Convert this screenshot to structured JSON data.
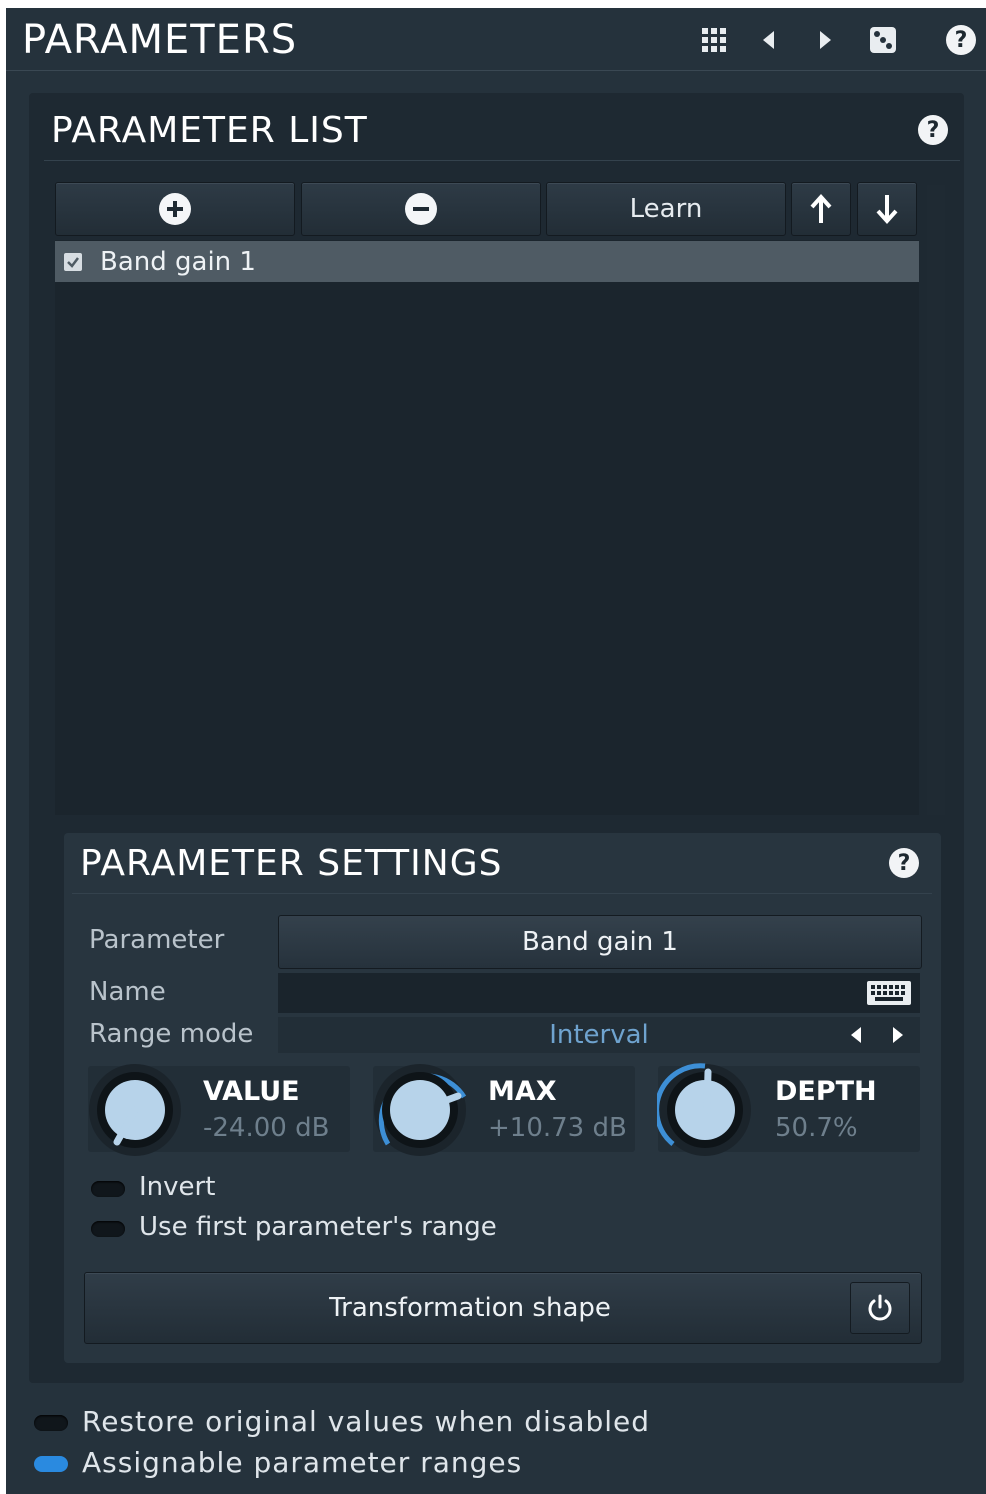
{
  "header": {
    "title": "PARAMETERS",
    "icons": [
      "grid-icon",
      "prev-arrow-icon",
      "next-arrow-icon",
      "dice-icon",
      "help-icon"
    ],
    "help_glyph": "?"
  },
  "parameter_list": {
    "title": "PARAMETER LIST",
    "help_glyph": "?",
    "toolbar": {
      "learn_label": "Learn"
    },
    "items": [
      {
        "label": "Band gain 1",
        "checked": true,
        "selected": true
      }
    ]
  },
  "parameter_settings": {
    "title": "PARAMETER SETTINGS",
    "help_glyph": "?",
    "parameter_label": "Parameter",
    "parameter_value": "Band gain 1",
    "name_label": "Name",
    "name_value": "",
    "range_mode_label": "Range mode",
    "range_mode_value": "Interval",
    "knobs": {
      "value": {
        "name": "VALUE",
        "display": "-24.00 dB"
      },
      "max": {
        "name": "MAX",
        "display": "+10.73 dB"
      },
      "depth": {
        "name": "DEPTH",
        "display": "50.7%"
      }
    },
    "invert_label": "Invert",
    "invert_on": false,
    "use_first_range_label": "Use first parameter's range",
    "use_first_range_on": false,
    "transformation_shape_label": "Transformation shape"
  },
  "footer": {
    "restore_label": "Restore original values when disabled",
    "restore_on": false,
    "assignable_label": "Assignable parameter ranges",
    "assignable_on": true
  },
  "colors": {
    "accent": "#2a8ae0",
    "knob_ring": "#3d8fd6",
    "panel": "#25323c"
  }
}
